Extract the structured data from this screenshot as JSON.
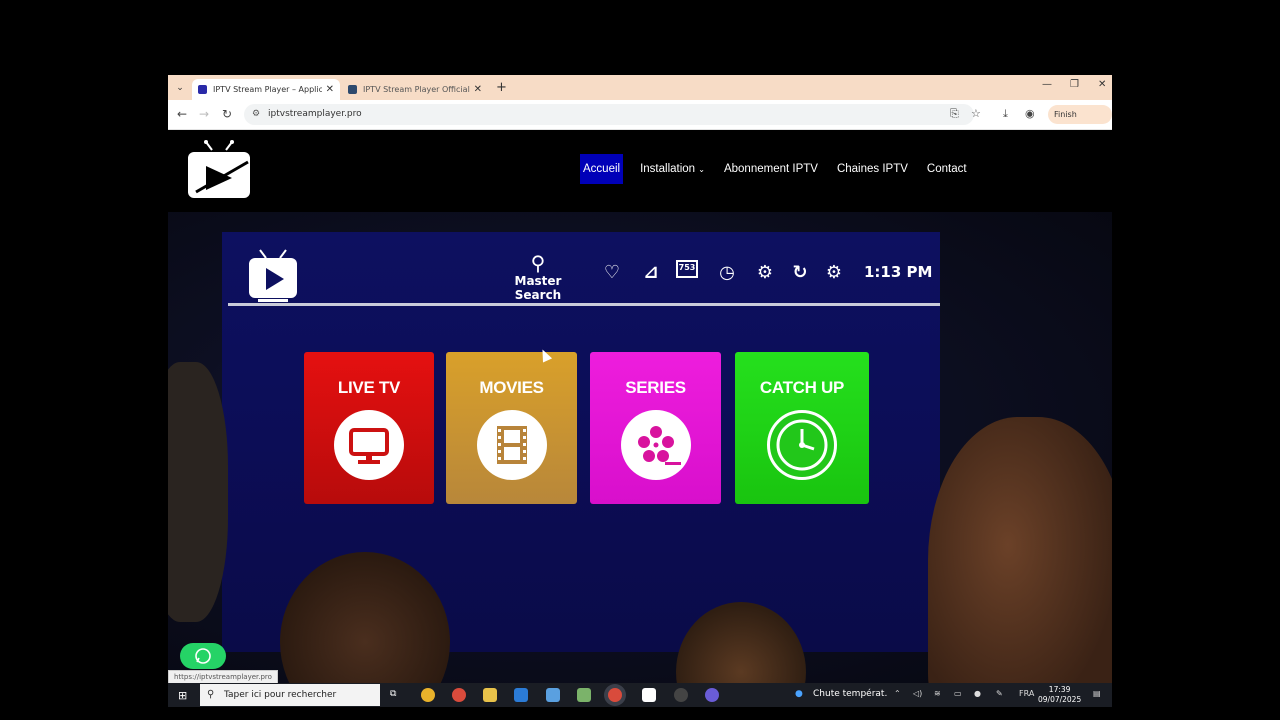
{
  "browser": {
    "tabs": [
      {
        "title": "IPTV Stream Player – Application",
        "active": true
      },
      {
        "title": "IPTV Stream Player Official : télé",
        "active": false
      }
    ],
    "url": "iptvstreamplayer.pro",
    "finish_update_label": "Finish update",
    "status_url": "https://iptvstreamplayer.pro"
  },
  "site": {
    "nav": [
      {
        "label": "Accueil",
        "active": true
      },
      {
        "label": "Installation",
        "dropdown": true
      },
      {
        "label": "Abonnement IPTV"
      },
      {
        "label": "Chaines IPTV"
      },
      {
        "label": "Contact"
      }
    ]
  },
  "tv": {
    "search_label": "Master Search",
    "time": "1:13 PM",
    "icon_badge": "753",
    "tiles": [
      {
        "label": "LIVE TV",
        "color": "#e01010"
      },
      {
        "label": "MOVIES",
        "color": "#d19a2f"
      },
      {
        "label": "SERIES",
        "color": "#e81ad8"
      },
      {
        "label": "CATCH UP",
        "color": "#22d91a"
      }
    ]
  },
  "taskbar": {
    "search_placeholder": "Taper ici pour rechercher",
    "weather": "Chute températ.",
    "language": "FRA",
    "time": "17:39",
    "date": "09/07/2025"
  }
}
